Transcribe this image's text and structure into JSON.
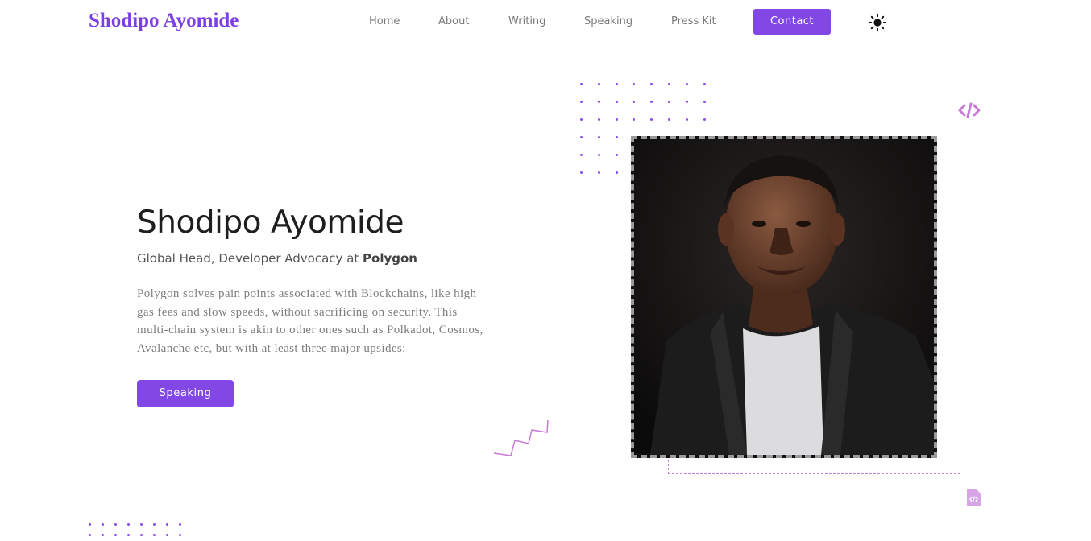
{
  "header": {
    "brand": "Shodipo Ayomide",
    "nav": {
      "home": "Home",
      "about": "About",
      "writing": "Writing",
      "speaking": "Speaking",
      "press_kit": "Press Kit",
      "contact": "Contact"
    },
    "theme_toggle_icon": "sun-icon"
  },
  "hero": {
    "name": "Shodipo Ayomide",
    "role_prefix": "Global Head, Developer Advocacy at ",
    "role_company": "Polygon",
    "description": "Polygon solves pain points associated with Blockchains, like high gas fees and slow speeds, without sacrificing on security. This multi-chain system is akin to other ones such as Polkadot, Cosmos, Avalanche etc, but with at least three major upsides:",
    "cta": "Speaking"
  },
  "decorations": {
    "code_icon": "code-icon",
    "file_code_icon": "file-code-icon",
    "zigzag": "zigzag-line"
  },
  "colors": {
    "accent": "#8247e5",
    "brand_text": "#7b3fe4",
    "decor_light": "#c77ad6"
  }
}
